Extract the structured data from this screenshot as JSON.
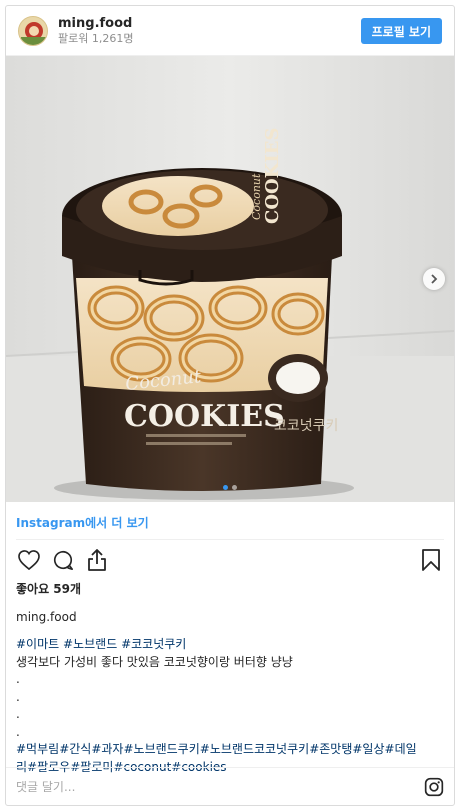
{
  "header": {
    "username": "ming.food",
    "followers": "팔로워 1,261명",
    "profile_button": "프로필 보기"
  },
  "media": {
    "product_brand": "Coconut",
    "product_name": "COOKIES",
    "side_label": "코코넛쿠키",
    "lid_title": "Coconut COOKIES",
    "carousel_dots": 2,
    "active_dot": 1
  },
  "more_link": "Instagram에서 더 보기",
  "icons": [
    "heart-icon",
    "comment-icon",
    "share-icon",
    "bookmark-icon",
    "instagram-icon"
  ],
  "likes": "좋아요 59개",
  "author": "ming.food",
  "caption": {
    "hashtags_top": [
      "#이마트",
      "#노브랜드",
      "#코코넛쿠키"
    ],
    "text": "생각보다 가성비 좋다 맛있음 코코넛향이랑 버터향 냥냥",
    "dots": [
      ".",
      ".",
      ".",
      "."
    ],
    "hashtags_line1": [
      "#먹부림",
      "#간식",
      "#과자",
      "#노브랜드쿠키",
      "#노브랜드코코넛쿠키",
      "#존맛탱",
      "#일상",
      "#데일"
    ],
    "hashtags_line2": [
      "리",
      "#팔로우",
      "#팔로미",
      "#coconut",
      "#cookies"
    ]
  },
  "comment": {
    "placeholder": "댓글 달기..."
  },
  "colors": {
    "accent": "#3897f0",
    "tag": "#003569",
    "tub_brown": "#3b2a1f"
  }
}
